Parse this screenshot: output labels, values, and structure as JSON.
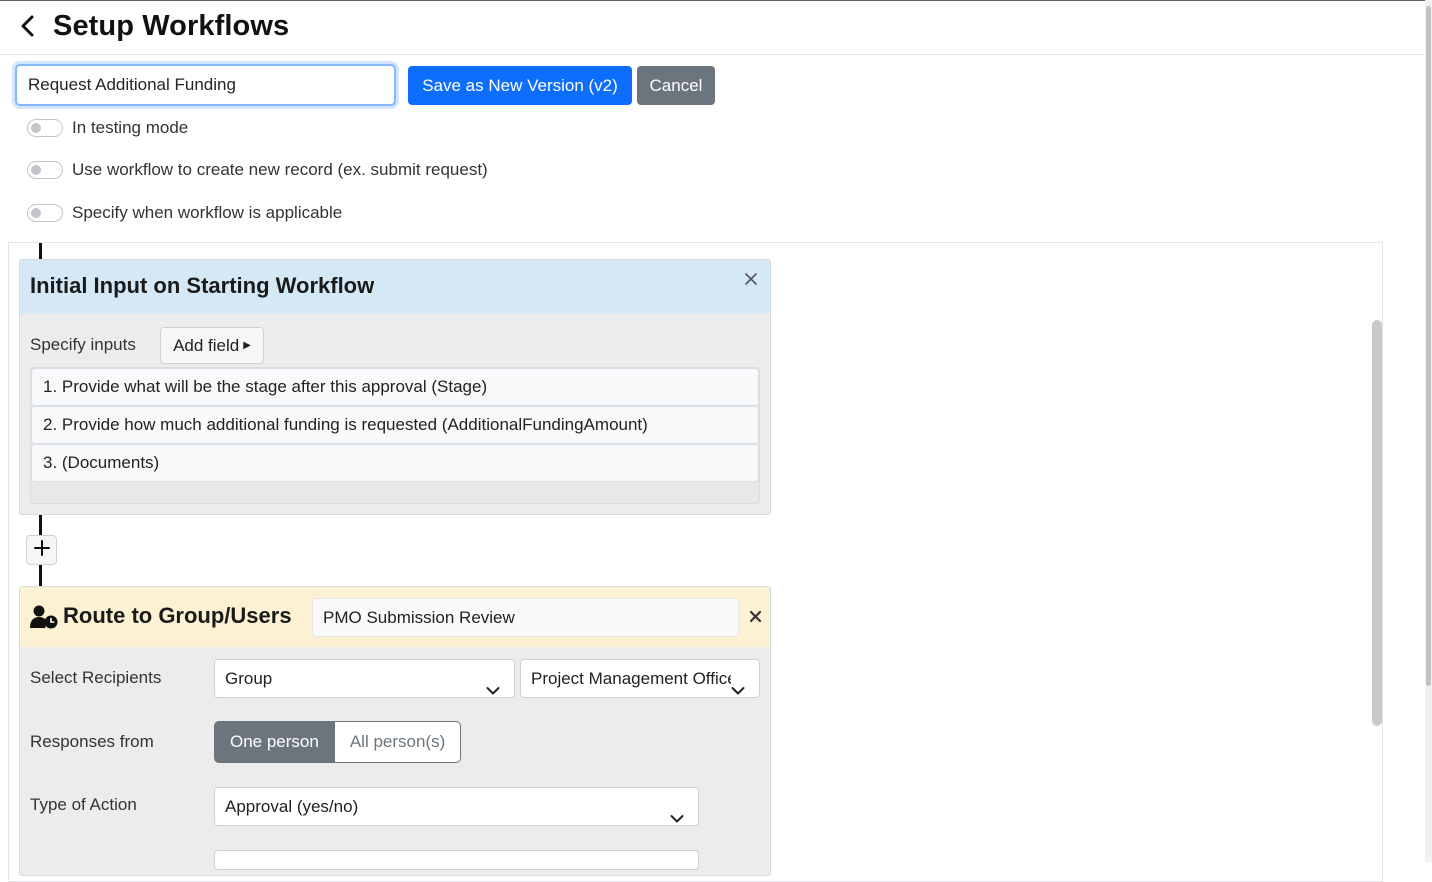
{
  "header": {
    "title": "Setup Workflows",
    "back_icon": "chevron-left-icon"
  },
  "workflow": {
    "name_value": "Request Additional Funding",
    "save_label": "Save as New Version (v2)",
    "cancel_label": "Cancel"
  },
  "toggles": [
    {
      "label": "In testing mode",
      "on": false
    },
    {
      "label": "Use workflow to create new record (ex. submit request)",
      "on": false
    },
    {
      "label": "Specify when workflow is applicable",
      "on": false
    }
  ],
  "colors": {
    "primary": "#0d6efd",
    "secondary": "#6c757d",
    "input_card_header": "#d5e8f6",
    "route_card_header": "#fcf2d3"
  },
  "input_card": {
    "title": "Initial Input on Starting Workflow",
    "close_icon": "close-icon",
    "specify_label": "Specify inputs",
    "add_field_label": "Add field",
    "fields": [
      "1. Provide what will be the stage after this approval (Stage)",
      "2. Provide how much additional funding is requested (AdditionalFundingAmount)",
      "3. (Documents)"
    ]
  },
  "add_step_icon": "plus-icon",
  "route_card": {
    "icon": "user-clock-icon",
    "title": "Route to Group/Users",
    "step_name_value": "PMO Submission Review",
    "close_icon": "close-icon",
    "recipients_label": "Select Recipients",
    "recipient_type": "Group",
    "recipient_group": "Project Management Office",
    "responses_label": "Responses from",
    "responses_options": [
      "One person",
      "All person(s)"
    ],
    "responses_selected": "One person",
    "action_label": "Type of Action",
    "action_value": "Approval (yes/no)"
  }
}
